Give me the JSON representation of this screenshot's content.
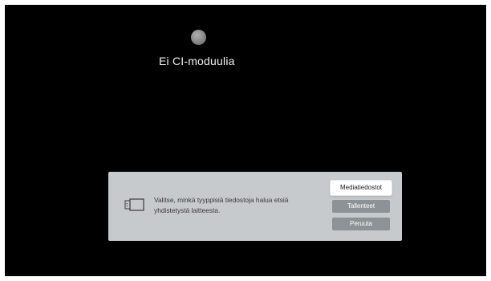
{
  "status": {
    "title": "Ei CI-moduulia"
  },
  "dialog": {
    "icon": "usb-device-icon",
    "message": "Valitse, minkä tyyppisiä tiedostoja halua etsiä yhdistetystä laitteesta.",
    "buttons": {
      "media_files": "Mediatiedostot",
      "recordings": "Tallenteet",
      "cancel": "Peruuta"
    }
  },
  "colors": {
    "screen_background": "#000000",
    "dialog_background": "#c6cacc",
    "primary_button": "#ffffff",
    "secondary_button": "#8c9296"
  }
}
